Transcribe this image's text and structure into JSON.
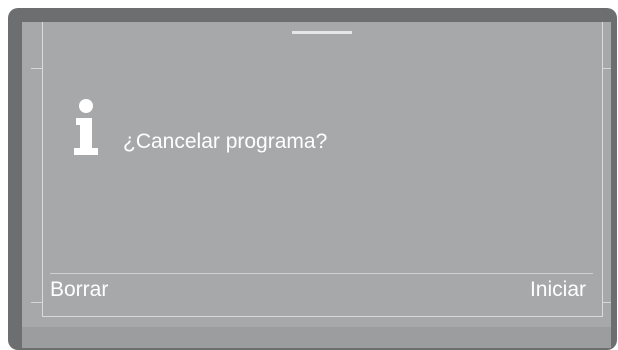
{
  "dialog": {
    "icon": "info-icon",
    "message": "¿Cancelar programa?"
  },
  "softkeys": {
    "left_label": "Borrar",
    "right_label": "Iniciar"
  },
  "colors": {
    "bezel": "#6d6e70",
    "screen": "#a7a8aa",
    "text": "#ffffff"
  }
}
